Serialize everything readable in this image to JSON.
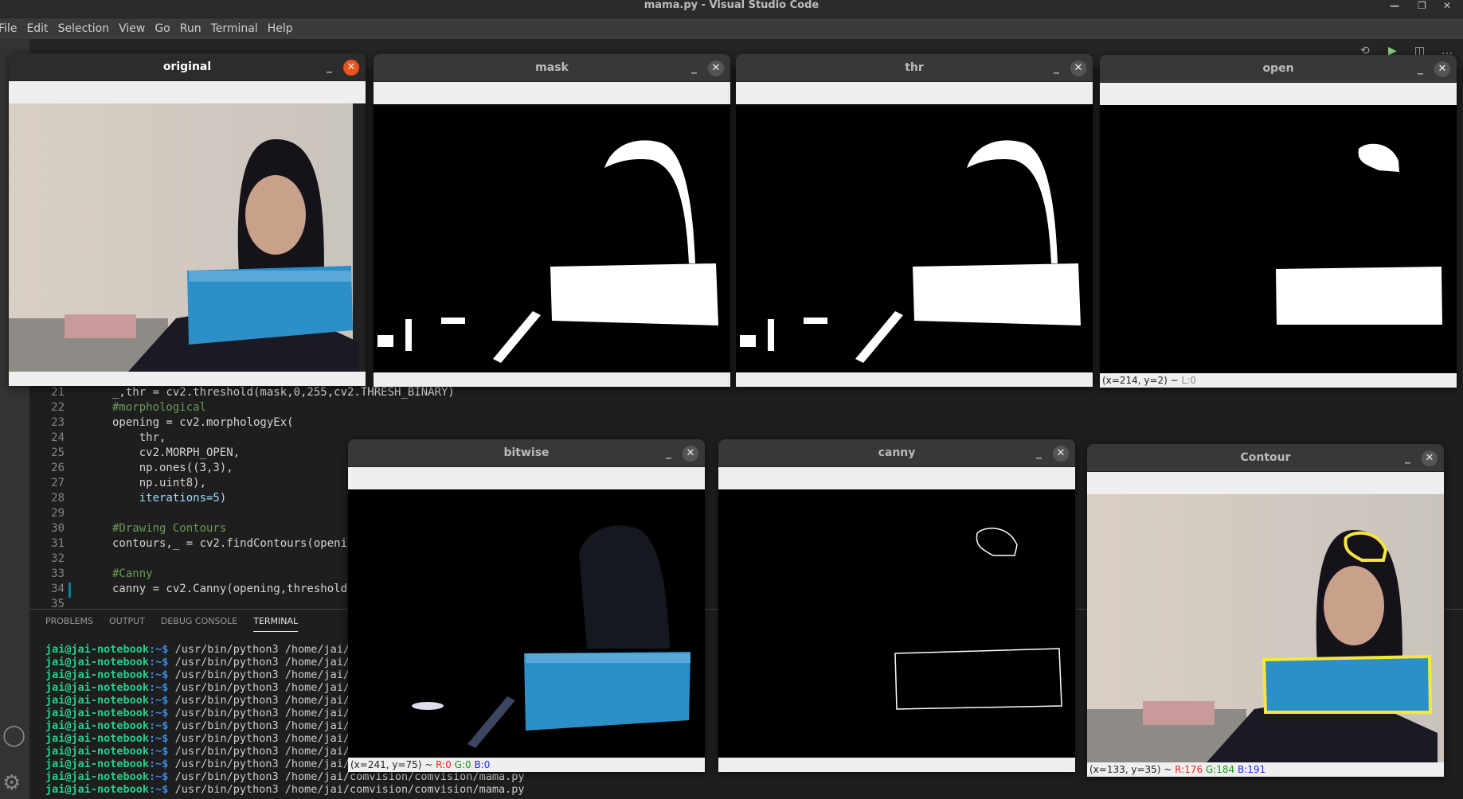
{
  "window_title": "mama.py - Visual Studio Code",
  "menu": [
    "File",
    "Edit",
    "Selection",
    "View",
    "Go",
    "Run",
    "Terminal",
    "Help"
  ],
  "code": {
    "line_numbers": [
      "21",
      "22",
      "23",
      "24",
      "25",
      "26",
      "27",
      "28",
      "29",
      "30",
      "31",
      "32",
      "33",
      "34",
      "35"
    ],
    "lines": [
      "_,thr = cv2.threshold(mask,0,255,cv2.THRESH_BINARY)",
      "#morphological",
      "opening = cv2.morphologyEx(",
      "    thr,",
      "    cv2.MORPH_OPEN,",
      "    np.ones((3,3),",
      "    np.uint8),",
      "    iterations=5)",
      "",
      "#Drawing Contours",
      "contours,_ = cv2.findContours(openi",
      "",
      "#Canny",
      "canny = cv2.Canny(opening,threshold",
      ""
    ]
  },
  "panel": {
    "tabs": [
      "PROBLEMS",
      "OUTPUT",
      "DEBUG CONSOLE",
      "TERMINAL"
    ],
    "active_tab": "TERMINAL"
  },
  "terminal": {
    "prompt": "jai@jai-notebook",
    "path": ":~$",
    "command": " /usr/bin/python3 /home/jai/comvision/comvision/mama.py",
    "count": 12
  },
  "windows": {
    "original": {
      "title": "original",
      "status": ""
    },
    "mask": {
      "title": "mask",
      "status": ""
    },
    "thr": {
      "title": "thr",
      "status": ""
    },
    "open": {
      "title": "open",
      "status_pos": "(x=214, y=2) ~ ",
      "status_l": "L:0"
    },
    "bitwise": {
      "title": "bitwise",
      "status_pos": "(x=241, y=75) ~ ",
      "r": "R:0",
      "g": "G:0",
      "b": "B:0"
    },
    "canny": {
      "title": "canny",
      "status": ""
    },
    "contour": {
      "title": "Contour",
      "status_pos": "(x=133, y=35) ~ ",
      "r": "R:176",
      "g": "G:184",
      "b": "B:191"
    }
  },
  "colors": {
    "accent_close": "#e95420",
    "contour": "#f5e642",
    "prompt": "#23d18b"
  }
}
